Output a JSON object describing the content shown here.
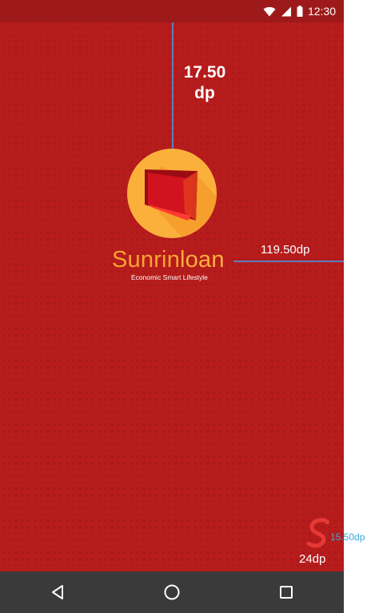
{
  "status_bar": {
    "time": "12:30",
    "icons": [
      "wifi-icon",
      "cellular-signal-icon",
      "battery-icon"
    ]
  },
  "annotations": {
    "top_gap_value": "17.50",
    "top_gap_unit": "dp",
    "right_gap": "119.50dp",
    "corner_small": "15.50dp",
    "bottom_gap": "24dp"
  },
  "brand": {
    "name_part1": "Sunrin",
    "name_part2": "loan",
    "tagline": "Economic Smart Lifestyle"
  },
  "navigation": {
    "buttons": [
      "back-icon",
      "home-icon",
      "recents-icon"
    ]
  },
  "colors": {
    "background": "#b71c1c",
    "status_bar": "#9e1a1a",
    "nav_bar": "#3a3a3a",
    "logo_circle": "#fbb03b",
    "logo_book": "#c8102e",
    "guide_line": "#5b7fc0",
    "small_dim_text": "#3aa7d9"
  }
}
